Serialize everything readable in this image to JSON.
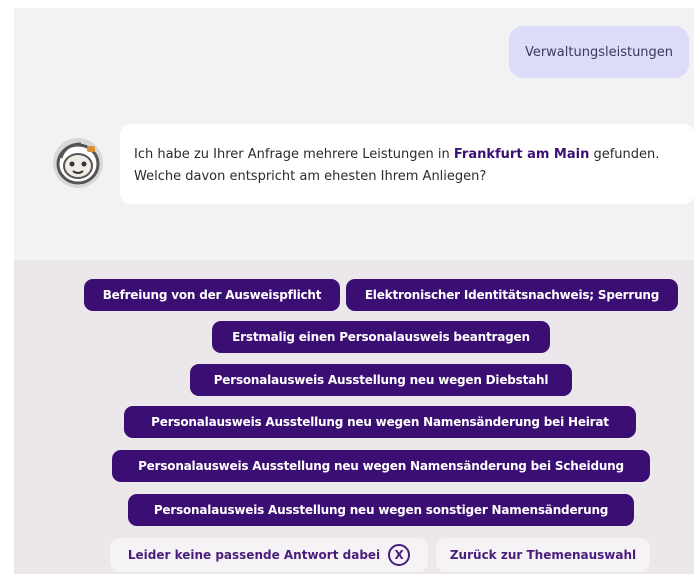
{
  "chat": {
    "user_message": "Verwaltungsleistungen",
    "bot_message": {
      "part1": "Ich habe zu Ihrer Anfrage mehrere Leistungen in ",
      "highlight": "Frankfurt am Main",
      "part2": " gefunden.",
      "line2": "Welche davon entspricht am ehesten Ihrem Anliegen?"
    }
  },
  "options": [
    "Befreiung von der Ausweispflicht",
    "Elektronischer Identitätsnachweis; Sperrung",
    "Erstmalig einen Personalausweis beantragen",
    "Personalausweis Ausstellung neu wegen Diebstahl",
    "Personalausweis Ausstellung neu wegen Namensänderung bei Heirat",
    "Personalausweis Ausstellung neu wegen Namensänderung bei Scheidung",
    "Personalausweis Ausstellung neu wegen sonstiger Namensänderung"
  ],
  "footer": {
    "no_match_label": "Leider keine passende Antwort dabei",
    "no_match_icon": "X",
    "back_label": "Zurück zur Themenauswahl"
  },
  "colors": {
    "chip_bg": "#3b0e74",
    "user_bubble": "#dcdcf8",
    "highlight": "#3b1074"
  }
}
